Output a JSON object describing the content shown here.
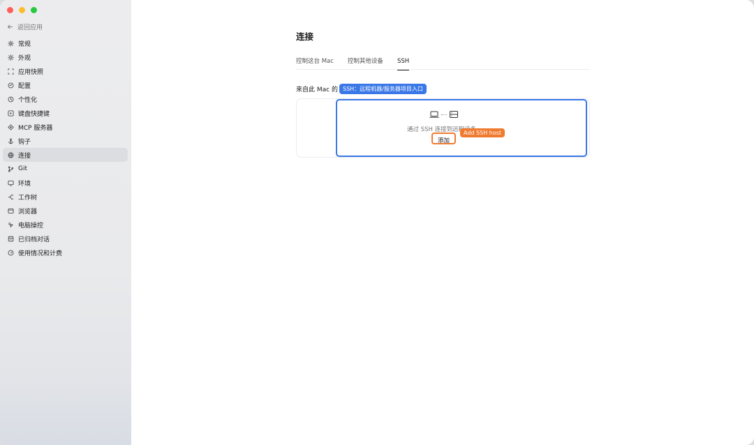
{
  "sidebar": {
    "back_label": "返回应用",
    "items": [
      {
        "label": "常规",
        "icon": "gear-icon"
      },
      {
        "label": "外观",
        "icon": "sun-icon"
      },
      {
        "label": "应用快照",
        "icon": "snapshot-icon"
      },
      {
        "label": "配置",
        "icon": "config-icon"
      },
      {
        "label": "个性化",
        "icon": "personalize-icon"
      },
      {
        "label": "键盘快捷键",
        "icon": "keyboard-icon"
      },
      {
        "label": "MCP 服务器",
        "icon": "mcp-icon"
      },
      {
        "label": "钩子",
        "icon": "anchor-icon"
      },
      {
        "label": "连接",
        "icon": "globe-icon"
      },
      {
        "label": "Git",
        "icon": "git-branch-icon"
      },
      {
        "label": "环境",
        "icon": "monitor-icon"
      },
      {
        "label": "工作树",
        "icon": "worktree-icon"
      },
      {
        "label": "浏览器",
        "icon": "browser-icon"
      },
      {
        "label": "电脑操控",
        "icon": "cursor-icon"
      },
      {
        "label": "已归档对话",
        "icon": "archive-icon"
      },
      {
        "label": "使用情况和计费",
        "icon": "gauge-icon"
      }
    ],
    "active_index": 8
  },
  "main": {
    "title": "连接",
    "tabs": [
      {
        "label": "控制这台 Mac"
      },
      {
        "label": "控制其他设备"
      },
      {
        "label": "SSH"
      }
    ],
    "active_tab": 2,
    "section_label": "来自此 Mac 的 S",
    "empty_text": "通过 SSH 连接到远程设备",
    "add_button_label": "添加"
  },
  "annotations": {
    "blue_tag": "SSH：远程机器/服务器项目入口",
    "orange_tag": "Add SSH host"
  },
  "colors": {
    "highlight_blue": "#3a78e8",
    "highlight_orange": "#f07a30"
  }
}
